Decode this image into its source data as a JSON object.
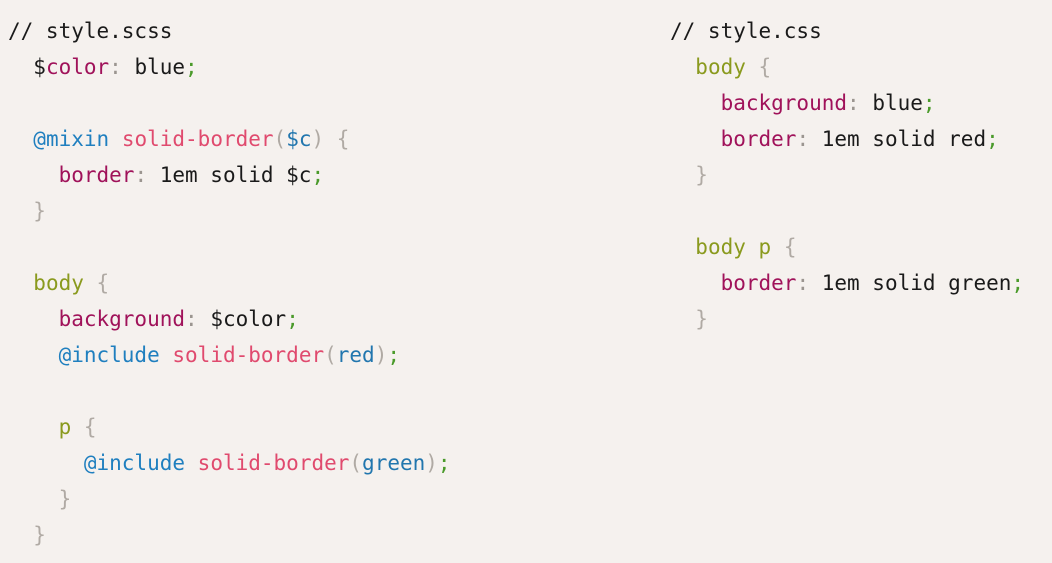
{
  "background_color": "#f5f1ee",
  "palette": {
    "comment": "#1a1a1a",
    "variable_name": "#a0125a",
    "property": "#a0125a",
    "colon": "#9b9590",
    "semicolon": "#4a9a2a",
    "selector": "#8a9a1e",
    "brace": "#b0aaa4",
    "paren": "#b0aaa4",
    "at_rule": "#1f7fbf",
    "mixin_name": "#e04a6e",
    "argument": "#2176ae",
    "value": "#1a1a1a"
  },
  "panes": [
    {
      "id": "scss-pane",
      "filename": "// style.scss",
      "language": "scss",
      "lines": [
        {
          "indent": 0,
          "tokens": [
            {
              "t": "// style.scss",
              "c": "comment"
            }
          ]
        },
        {
          "indent": 1,
          "tokens": [
            {
              "t": "$",
              "c": "var"
            },
            {
              "t": "color",
              "c": "varname"
            },
            {
              "t": ":",
              "c": "colon"
            },
            {
              "t": " blue",
              "c": "value"
            },
            {
              "t": ";",
              "c": "semi"
            }
          ]
        },
        {
          "indent": 0,
          "tokens": []
        },
        {
          "indent": 1,
          "tokens": [
            {
              "t": "@mixin",
              "c": "atrule"
            },
            {
              "t": " ",
              "c": "plain"
            },
            {
              "t": "solid-border",
              "c": "mixin"
            },
            {
              "t": "(",
              "c": "paren"
            },
            {
              "t": "$c",
              "c": "arg"
            },
            {
              "t": ")",
              "c": "paren"
            },
            {
              "t": " ",
              "c": "plain"
            },
            {
              "t": "{",
              "c": "brace"
            }
          ]
        },
        {
          "indent": 2,
          "tokens": [
            {
              "t": "border",
              "c": "prop"
            },
            {
              "t": ":",
              "c": "colon"
            },
            {
              "t": " 1em solid $c",
              "c": "value"
            },
            {
              "t": ";",
              "c": "semi"
            }
          ]
        },
        {
          "indent": 1,
          "tokens": [
            {
              "t": "}",
              "c": "brace"
            }
          ]
        },
        {
          "indent": 0,
          "tokens": []
        },
        {
          "indent": 1,
          "tokens": [
            {
              "t": "body",
              "c": "selector"
            },
            {
              "t": " ",
              "c": "plain"
            },
            {
              "t": "{",
              "c": "brace"
            }
          ]
        },
        {
          "indent": 2,
          "tokens": [
            {
              "t": "background",
              "c": "prop"
            },
            {
              "t": ":",
              "c": "colon"
            },
            {
              "t": " $color",
              "c": "value"
            },
            {
              "t": ";",
              "c": "semi"
            }
          ]
        },
        {
          "indent": 2,
          "tokens": [
            {
              "t": "@include",
              "c": "atrule"
            },
            {
              "t": " ",
              "c": "plain"
            },
            {
              "t": "solid-border",
              "c": "mixin"
            },
            {
              "t": "(",
              "c": "paren"
            },
            {
              "t": "red",
              "c": "arg"
            },
            {
              "t": ")",
              "c": "paren"
            },
            {
              "t": ";",
              "c": "semi"
            }
          ]
        },
        {
          "indent": 0,
          "tokens": []
        },
        {
          "indent": 2,
          "tokens": [
            {
              "t": "p",
              "c": "selector"
            },
            {
              "t": " ",
              "c": "plain"
            },
            {
              "t": "{",
              "c": "brace"
            }
          ]
        },
        {
          "indent": 3,
          "tokens": [
            {
              "t": "@include",
              "c": "atrule"
            },
            {
              "t": " ",
              "c": "plain"
            },
            {
              "t": "solid-border",
              "c": "mixin"
            },
            {
              "t": "(",
              "c": "paren"
            },
            {
              "t": "green",
              "c": "arg"
            },
            {
              "t": ")",
              "c": "paren"
            },
            {
              "t": ";",
              "c": "semi"
            }
          ]
        },
        {
          "indent": 2,
          "tokens": [
            {
              "t": "}",
              "c": "brace"
            }
          ]
        },
        {
          "indent": 1,
          "tokens": [
            {
              "t": "}",
              "c": "brace"
            }
          ]
        }
      ]
    },
    {
      "id": "css-pane",
      "filename": "// style.css",
      "language": "css",
      "lines": [
        {
          "indent": 0,
          "tokens": [
            {
              "t": "// style.css",
              "c": "comment"
            }
          ]
        },
        {
          "indent": 1,
          "tokens": [
            {
              "t": "body",
              "c": "selector"
            },
            {
              "t": " ",
              "c": "plain"
            },
            {
              "t": "{",
              "c": "brace"
            }
          ]
        },
        {
          "indent": 2,
          "tokens": [
            {
              "t": "background",
              "c": "prop"
            },
            {
              "t": ":",
              "c": "colon"
            },
            {
              "t": " blue",
              "c": "value"
            },
            {
              "t": ";",
              "c": "semi"
            }
          ]
        },
        {
          "indent": 2,
          "tokens": [
            {
              "t": "border",
              "c": "prop"
            },
            {
              "t": ":",
              "c": "colon"
            },
            {
              "t": " 1em solid red",
              "c": "value"
            },
            {
              "t": ";",
              "c": "semi"
            }
          ]
        },
        {
          "indent": 1,
          "tokens": [
            {
              "t": "}",
              "c": "brace"
            }
          ]
        },
        {
          "indent": 0,
          "tokens": []
        },
        {
          "indent": 1,
          "tokens": [
            {
              "t": "body p",
              "c": "selector"
            },
            {
              "t": " ",
              "c": "plain"
            },
            {
              "t": "{",
              "c": "brace"
            }
          ]
        },
        {
          "indent": 2,
          "tokens": [
            {
              "t": "border",
              "c": "prop"
            },
            {
              "t": ":",
              "c": "colon"
            },
            {
              "t": " 1em solid green",
              "c": "value"
            },
            {
              "t": ";",
              "c": "semi"
            }
          ]
        },
        {
          "indent": 1,
          "tokens": [
            {
              "t": "}",
              "c": "brace"
            }
          ]
        }
      ]
    }
  ]
}
